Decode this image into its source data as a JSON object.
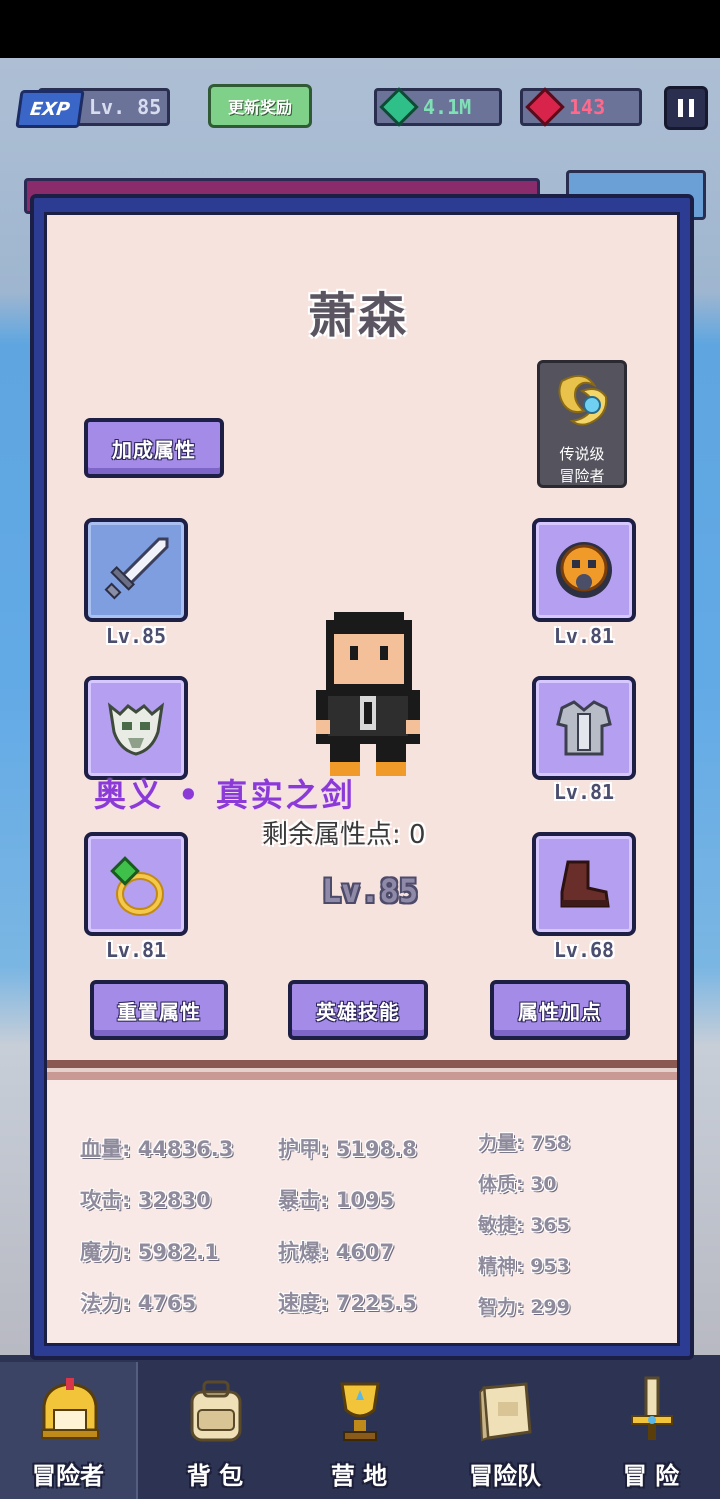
{
  "topbar": {
    "exp_badge": "EXP",
    "level": "Lv. 85",
    "refresh_label": "更新奖励",
    "emerald_amount": "4.1M",
    "ruby_amount": "143"
  },
  "hero": {
    "name": "萧森",
    "rank_line1": "传说级",
    "rank_line2": "冒险者",
    "bonus_button": "加成属性",
    "skill_name": "奥义 • 真实之剑",
    "remaining_points": "剩余属性点: 0",
    "level": "Lv.85"
  },
  "equipment": {
    "left": [
      {
        "item": "sword-icon",
        "level": "Lv.85"
      },
      {
        "item": "skull-helmet-icon",
        "level": ""
      },
      {
        "item": "ring-icon",
        "level": "Lv.81"
      }
    ],
    "right": [
      {
        "item": "amulet-icon",
        "level": "Lv.81"
      },
      {
        "item": "armor-icon",
        "level": "Lv.81"
      },
      {
        "item": "boots-icon",
        "level": "Lv.68"
      }
    ]
  },
  "actions": {
    "reset": "重置属性",
    "skills": "英雄技能",
    "allocate": "属性加点"
  },
  "stats": {
    "col1": [
      "血量: 44836.3",
      "攻击: 32830",
      "魔力: 5982.1",
      "法力: 4765"
    ],
    "col2": [
      "护甲: 5198.8",
      "暴击: 1095",
      "抗爆: 4607",
      "速度: 7225.5"
    ],
    "col3": [
      "力量: 758",
      "体质: 30",
      "敏捷: 365",
      "精神: 953",
      "智力: 299"
    ]
  },
  "nav": [
    {
      "label": "冒险者",
      "icon": "helmet-icon"
    },
    {
      "label": "背 包",
      "icon": "backpack-icon"
    },
    {
      "label": "营 地",
      "icon": "camp-trophy-icon"
    },
    {
      "label": "冒险队",
      "icon": "book-icon"
    },
    {
      "label": "冒 险",
      "icon": "sword-hilt-icon"
    }
  ],
  "colors": {
    "panel_border": "#2b3c92",
    "panel_bg": "#f7e3de",
    "slot_purple": "#b49ff0",
    "skill_text": "#8c3ad6"
  }
}
